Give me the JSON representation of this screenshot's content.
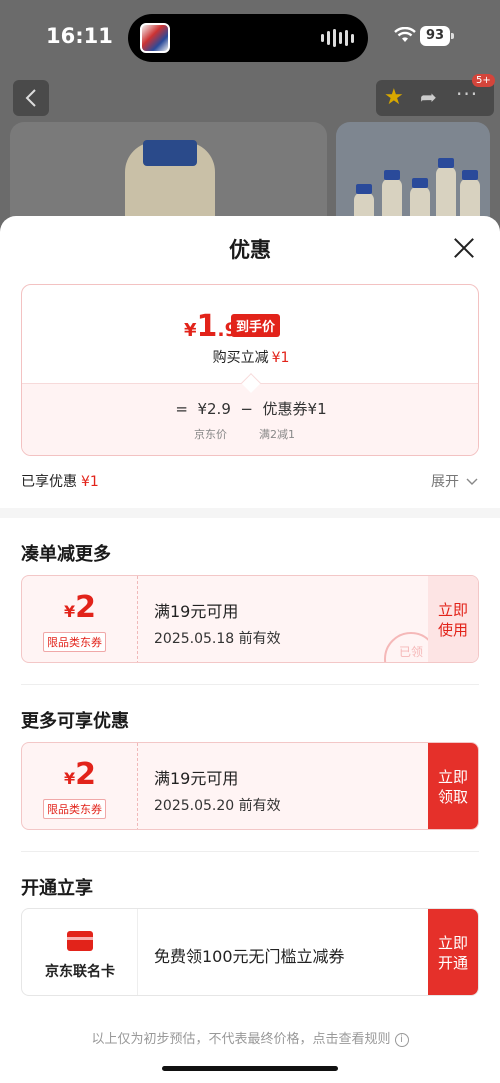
{
  "status": {
    "time": "16:11",
    "battery": "93"
  },
  "background_page": {
    "back_icon": "chevron-left-icon",
    "cart_badge": "5+"
  },
  "sheet": {
    "title": "优惠",
    "price_card": {
      "currency": "¥",
      "price_int": "1",
      "price_dec": ".9",
      "price_tag": "到手价",
      "reduce_label": "购买立减",
      "reduce_value": "¥1",
      "formula_eq": "=",
      "formula_price": "¥2.9",
      "formula_minus": "−",
      "formula_coupon": "优惠券¥1",
      "sub_price_label": "京东价",
      "sub_coupon_label": "满2减1"
    },
    "enjoyed_label": "已享优惠",
    "enjoyed_value": "¥1",
    "expand_label": "展开",
    "section_combine": {
      "title": "凑单减更多",
      "coupon": {
        "currency": "¥",
        "amount": "2",
        "tag": "限品类东券",
        "condition": "满19元可用",
        "expiry": "2025.05.18 前有效",
        "action_line1": "立即",
        "action_line2": "使用",
        "stamp": "已领"
      }
    },
    "section_more": {
      "title": "更多可享优惠",
      "coupon": {
        "currency": "¥",
        "amount": "2",
        "tag": "限品类东券",
        "condition": "满19元可用",
        "expiry": "2025.05.20 前有效",
        "action_line1": "立即",
        "action_line2": "领取"
      }
    },
    "section_open": {
      "title": "开通立享",
      "card_name": "京东联名卡",
      "description": "免费领100元无门槛立减券",
      "action_line1": "立即",
      "action_line2": "开通"
    },
    "footer_note": "以上仅为初步预估，不代表最终价格，点击查看规则"
  },
  "colors": {
    "accent_red": "#e2231a",
    "action_red": "#e5302a",
    "coupon_bg": "#fff4f4"
  }
}
